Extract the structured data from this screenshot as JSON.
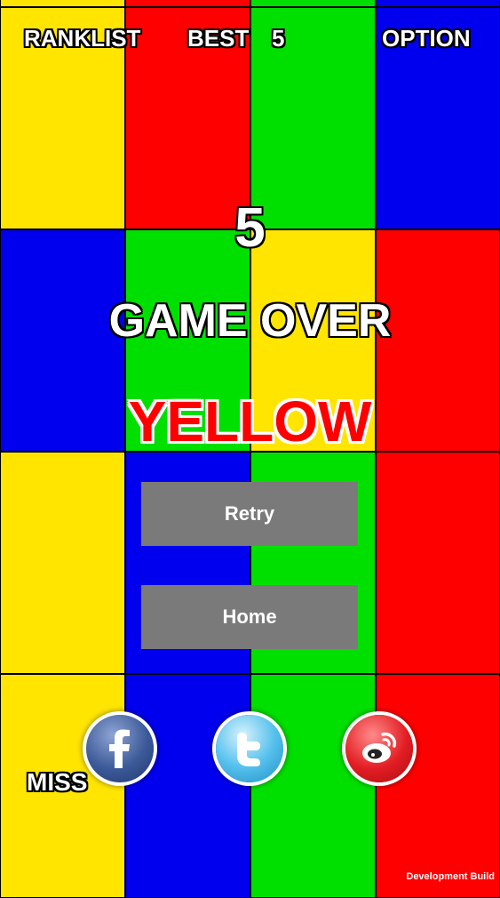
{
  "header": {
    "ranklist_label": "RANKLIST",
    "best_label": "BEST",
    "best_value": "5",
    "option_label": "OPTION"
  },
  "game": {
    "score": "5",
    "status": "GAME OVER",
    "target_color_word": "YELLOW",
    "target_color_hex": "#ff0000"
  },
  "buttons": {
    "retry_label": "Retry",
    "home_label": "Home"
  },
  "social": [
    {
      "name": "facebook-icon"
    },
    {
      "name": "twitter-icon"
    },
    {
      "name": "weibo-icon"
    }
  ],
  "miss_label": "MISS",
  "footer": {
    "build_label": "Development Build"
  },
  "palette": {
    "yellow": "#ffe500",
    "red": "#ff0000",
    "green": "#00e000",
    "blue": "#0000ee"
  },
  "grid_rows": [
    [
      "yellow",
      "red",
      "green",
      "blue"
    ],
    [
      "blue",
      "green",
      "yellow",
      "red"
    ],
    [
      "yellow",
      "blue",
      "green",
      "red"
    ],
    [
      "yellow",
      "blue",
      "green",
      "red"
    ]
  ]
}
